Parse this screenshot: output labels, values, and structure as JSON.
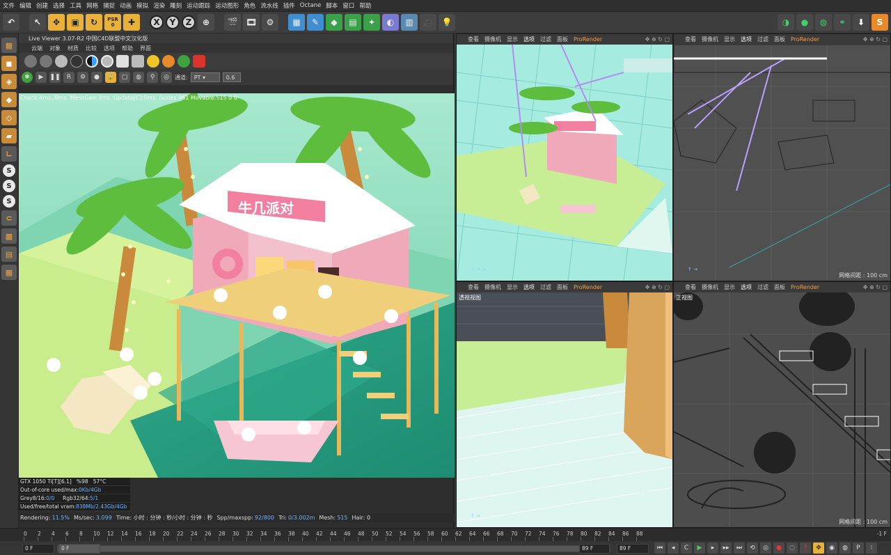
{
  "menu": [
    "文件",
    "编辑",
    "创建",
    "选择",
    "工具",
    "网格",
    "捕捉",
    "动画",
    "模拟",
    "渲染",
    "雕刻",
    "运动跟踪",
    "运动图形",
    "角色",
    "流水线",
    "插件",
    "Octane",
    "脚本",
    "窗口",
    "帮助"
  ],
  "toolbar": {
    "undo": "↶",
    "axis_x": "X",
    "axis_y": "Y",
    "axis_z": "Z",
    "psr_top": "PSR",
    "psr_bottom": "0"
  },
  "left_tools": [
    "S",
    "S",
    "S"
  ],
  "live_viewer": {
    "title": "Live Viewer 3.07-R2 中国C4D联盟中文汉化版",
    "menu": [
      "云端",
      "对象",
      "材质",
      "比较",
      "选项",
      "帮助",
      "界面"
    ],
    "channel_label": "通道:",
    "channel_value": "PT",
    "value_field": "0.6",
    "status": "Check:4ms./8ms. MeshGen:3ms. Update[C]:0ms. Nodes:861 Movable:515 0 0",
    "stats": {
      "gpu": "GTX 1050 Ti[T][6.1]",
      "gpu_util": "%98",
      "gpu_temp": "57°C",
      "out_of_core": "Out-of-core used/max:",
      "out_of_core_val": "0Kb/4Gb",
      "grey": "Grey8/16: ",
      "grey_val": "0/0",
      "rgb": "Rgb32/64: ",
      "rgb_val": "5/1",
      "vram": "Used/free/total vram: ",
      "vram_val": "838Mb/2.43Gb/4Gb"
    },
    "render_line": {
      "rendering_label": "Rendering:",
      "rendering_val": "11.5%",
      "ms_label": "Ms/sec:",
      "ms_val": "3.099",
      "time": "Time: 小时 : 分钟 : 秒/小时 : 分钟 : 秒",
      "spp_label": "Spp/maxspp:",
      "spp_val": "92/800",
      "tri_label": "Tri:",
      "tri_val": "0/3.002m",
      "mesh_label": "Mesh:",
      "mesh_val": "515",
      "hair": "Hair: 0"
    },
    "sign_text": "牛几派对"
  },
  "viewports": {
    "top_left": {
      "menu": [
        "查看",
        "摄像机",
        "显示",
        "选项",
        "过滤",
        "面板",
        "ProRender"
      ]
    },
    "top_right": {
      "menu": [
        "查看",
        "摄像机",
        "显示",
        "选项",
        "过滤",
        "面板",
        "ProRender"
      ],
      "grid": "网格间距 : 100 cm"
    },
    "bottom_left": {
      "menu": [
        "查看",
        "摄像机",
        "显示",
        "选项",
        "过滤",
        "面板",
        "ProRender"
      ],
      "label": "透视视图"
    },
    "bottom_right": {
      "menu": [
        "查看",
        "摄像机",
        "显示",
        "选项",
        "过滤",
        "面板",
        "ProRender"
      ],
      "label": "正视图",
      "grid": "网格间距 : 100 cm"
    }
  },
  "timeline": {
    "ticks": [
      "0",
      "2",
      "4",
      "6",
      "8",
      "10",
      "12",
      "14",
      "16",
      "18",
      "20",
      "22",
      "24",
      "26",
      "28",
      "30",
      "32",
      "34",
      "36",
      "38",
      "40",
      "42",
      "44",
      "46",
      "48",
      "50",
      "52",
      "54",
      "56",
      "58",
      "60",
      "62",
      "64",
      "66",
      "68",
      "70",
      "72",
      "74",
      "76",
      "78",
      "80",
      "82",
      "84",
      "86",
      "88"
    ],
    "end_frame": "-1 F",
    "start_field": "0 F",
    "current_field": "0 F",
    "max_field": "89 F",
    "max_field2": "89 F"
  }
}
